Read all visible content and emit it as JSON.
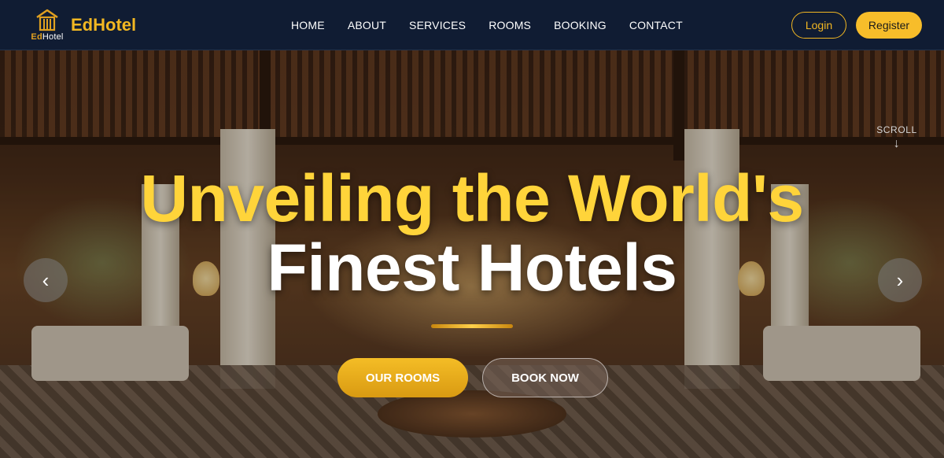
{
  "brand": {
    "logo_text_bold": "Ed",
    "logo_text_light": "Hotel",
    "name": "EdHotel",
    "logo_icon": "hotel-building-icon"
  },
  "nav": {
    "items": [
      {
        "label": "HOME"
      },
      {
        "label": "ABOUT"
      },
      {
        "label": "SERVICES"
      },
      {
        "label": "ROOMS"
      },
      {
        "label": "BOOKING"
      },
      {
        "label": "CONTACT"
      }
    ]
  },
  "auth": {
    "login_label": "Login",
    "register_label": "Register"
  },
  "hero": {
    "scroll_label": "SCROLL",
    "scroll_arrow": "↓",
    "headline_line1": "Unveiling the World's",
    "headline_line2": "Finest Hotels",
    "primary_button": "OUR ROOMS",
    "secondary_button": "BOOK NOW",
    "prev_arrow": "‹",
    "next_arrow": "›"
  },
  "colors": {
    "navbar_bg": "#101c33",
    "accent": "#f2b722",
    "headline_gold": "#ffd43a"
  }
}
